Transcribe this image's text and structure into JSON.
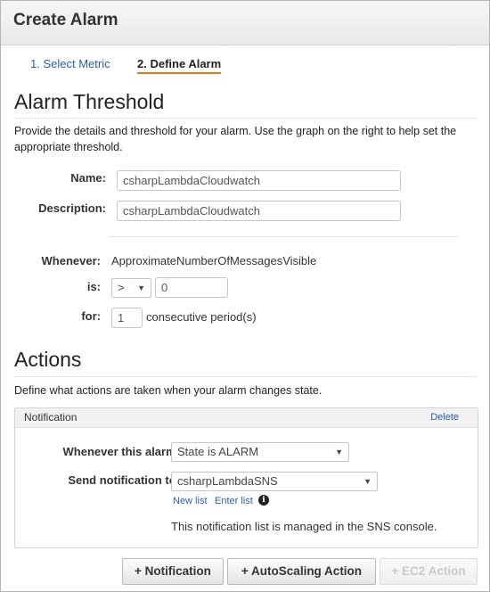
{
  "window": {
    "title": "Create Alarm"
  },
  "steps": [
    {
      "label": "1. Select Metric"
    },
    {
      "label": "2. Define Alarm"
    }
  ],
  "threshold": {
    "heading": "Alarm Threshold",
    "description": "Provide the details and threshold for your alarm. Use the graph on the right to help set the appropriate threshold.",
    "name_label": "Name:",
    "name_value": "csharpLambdaCloudwatch",
    "description_label": "Description:",
    "description_value": "csharpLambdaCloudwatch",
    "whenever_label": "Whenever:",
    "metric_name": "ApproximateNumberOfMessagesVisible",
    "is_label": "is:",
    "operator": ">",
    "threshold_value": "0",
    "for_label": "for:",
    "periods_value": "1",
    "periods_suffix": "consecutive period(s)"
  },
  "actions": {
    "heading": "Actions",
    "description": "Define what actions are taken when your alarm changes state.",
    "notification": {
      "title": "Notification",
      "delete_label": "Delete",
      "whenever_label": "Whenever this alarm:",
      "state_value": "State is ALARM",
      "send_label": "Send notification to:",
      "topic_value": "csharpLambdaSNS",
      "new_list_label": "New list",
      "enter_list_label": "Enter list",
      "managed_note": "This notification list is managed in the SNS console."
    }
  },
  "buttons": {
    "notification": "+ Notification",
    "autoscaling": "+ AutoScaling Action",
    "ec2": "+ EC2 Action"
  }
}
